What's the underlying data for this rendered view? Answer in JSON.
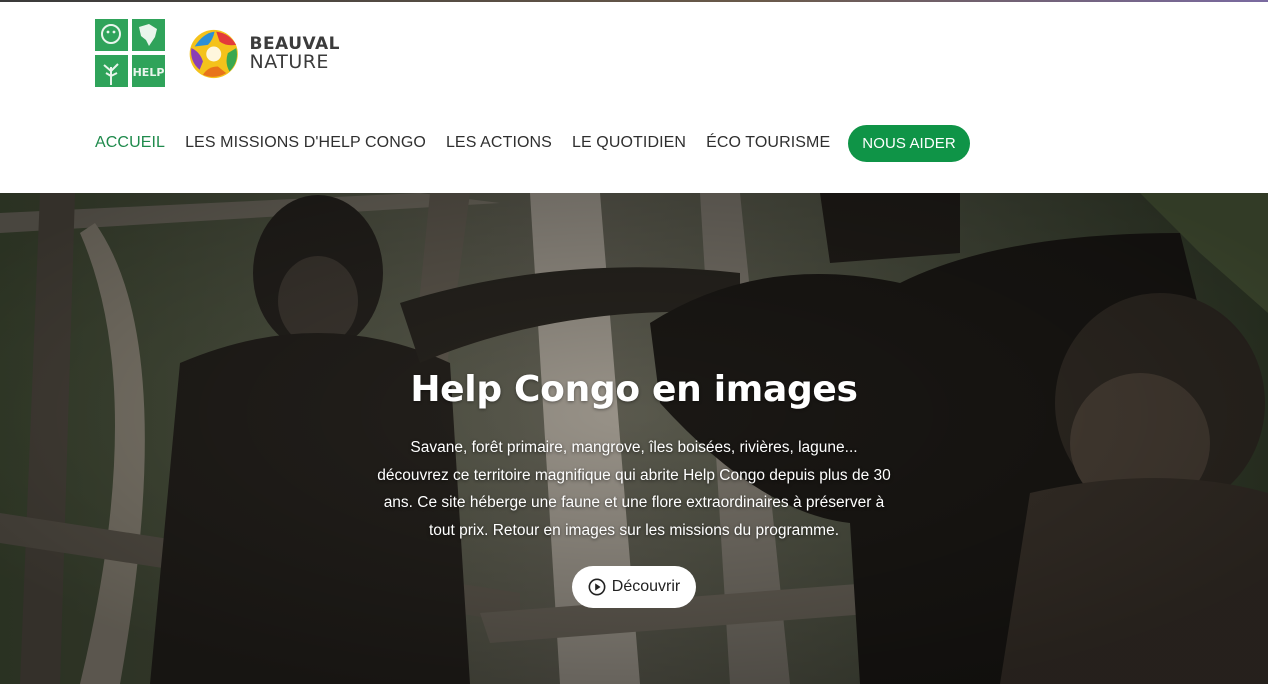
{
  "header": {
    "help_logo_text": "HELP",
    "beauval_logo": {
      "line1": "BEAUVAL",
      "line2": "NATURE"
    }
  },
  "nav": {
    "items": [
      {
        "label": "ACCUEIL",
        "active": true
      },
      {
        "label": "LES MISSIONS D'HELP CONGO"
      },
      {
        "label": "LES ACTIONS"
      },
      {
        "label": "LE QUOTIDIEN"
      },
      {
        "label": "ÉCO TOURISME"
      }
    ],
    "cta": "NOUS AIDER"
  },
  "hero": {
    "title": "Help Congo en images",
    "description": "Savane, forêt primaire, mangrove, îles boisées, rivières, lagune... découvrez ce territoire magnifique qui abrite Help Congo depuis plus de 30 ans. Ce site héberge une faune et une flore extraordinaires à préserver à tout prix. Retour en images sur les missions du programme.",
    "button_label": "Découvrir",
    "button_icon": "play-circle-icon"
  },
  "colors": {
    "accent": "#0f9447",
    "active_nav": "#1f8a4c"
  }
}
